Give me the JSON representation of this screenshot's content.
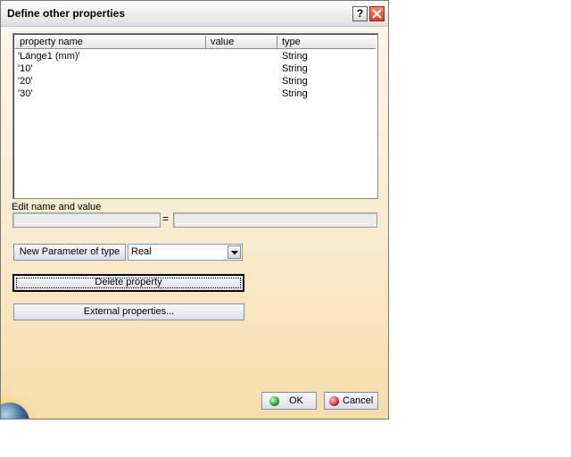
{
  "window": {
    "title": "Define other properties",
    "help_label": "?"
  },
  "list": {
    "columns": [
      "property name",
      "value",
      "type"
    ],
    "rows": [
      {
        "name": "'Länge1 (mm)'",
        "value": "",
        "type": "String"
      },
      {
        "name": "'10'",
        "value": "",
        "type": "String"
      },
      {
        "name": "'20'",
        "value": "",
        "type": "String"
      },
      {
        "name": "'30'",
        "value": "",
        "type": "String"
      }
    ]
  },
  "edit": {
    "label": "Edit name and value",
    "name_value": "",
    "equals": "=",
    "value_value": ""
  },
  "parameter": {
    "button_label": "New Parameter of type",
    "selected_type": "Real"
  },
  "actions": {
    "delete_label": "Delete property",
    "external_label": "External properties..."
  },
  "footer": {
    "ok_label": "OK",
    "cancel_label": "Cancel"
  },
  "colors": {
    "accent_green": "#1f9e27",
    "accent_red": "#d92a2a"
  }
}
